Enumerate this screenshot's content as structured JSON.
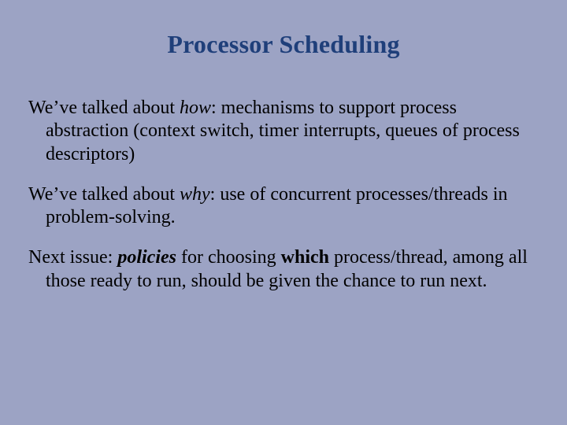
{
  "title": "Processor Scheduling",
  "p1": {
    "a": "We’ve talked about ",
    "b": "how",
    "c": ": mechanisms to support process abstraction (context switch, timer interrupts, queues of process descriptors)"
  },
  "p2": {
    "a": "We’ve talked about ",
    "b": "why",
    "c": ": use of concurrent processes/threads in problem-solving."
  },
  "p3": {
    "a": "Next issue: ",
    "b": "policies",
    "c": " for choosing ",
    "d": "which",
    "e": " process/thread, among all those ready to run, should be given the chance to run next."
  }
}
